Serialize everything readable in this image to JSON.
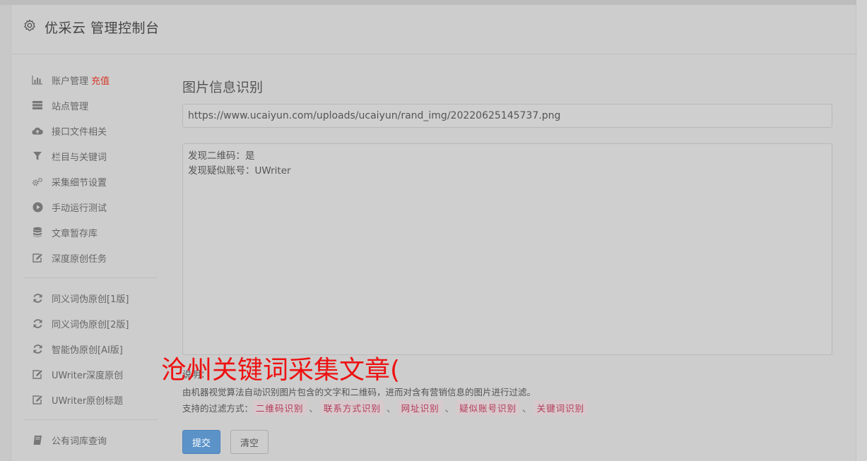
{
  "header": {
    "title": "优采云 管理控制台"
  },
  "sidebar": {
    "group1": [
      {
        "label": "账户管理",
        "badge": "充值",
        "icon": "bar-chart-icon"
      },
      {
        "label": "站点管理",
        "icon": "server-icon"
      },
      {
        "label": "接口文件相关",
        "icon": "cloud-upload-icon"
      },
      {
        "label": "栏目与关键词",
        "icon": "filter-icon"
      },
      {
        "label": "采集细节设置",
        "icon": "cogs-icon"
      },
      {
        "label": "手动运行测试",
        "icon": "play-circle-icon"
      },
      {
        "label": "文章暂存库",
        "icon": "database-icon"
      },
      {
        "label": "深度原创任务",
        "icon": "edit-icon"
      }
    ],
    "group2": [
      {
        "label": "同义词伪原创[1版]",
        "icon": "refresh-icon"
      },
      {
        "label": "同义词伪原创[2版]",
        "icon": "refresh-icon"
      },
      {
        "label": "智能伪原创[AI版]",
        "icon": "refresh-icon"
      },
      {
        "label": "UWriter深度原创",
        "icon": "edit-icon"
      },
      {
        "label": "UWriter原创标题",
        "icon": "edit-icon"
      }
    ],
    "group3": [
      {
        "label": "公有词库查询",
        "icon": "book-icon"
      }
    ]
  },
  "main": {
    "heading": "图片信息识别",
    "url_value": "https://www.ucaiyun.com/uploads/ucaiyun/rand_img/20220625145737.png",
    "result_lines": [
      "发现二维码：是",
      "发现疑似账号：UWriter"
    ],
    "hint_label": "说明：",
    "description": "由机器视觉算法自动识别图片包含的文字和二维码，进而对含有营销信息的图片进行过滤。",
    "methods_label": "支持的过滤方式：",
    "methods": [
      "二维码识别",
      "联系方式识别",
      "网址识别",
      "疑似账号识别",
      "关键词识别"
    ],
    "method_separator": "、",
    "submit_label": "提交",
    "clear_label": "清空"
  },
  "overlay_text": "沧州关键词采集文章(",
  "colors": {
    "primary": "#5b93c9",
    "badge": "#d43a2a",
    "overlay": "#ee1111",
    "tag_text": "#b33a5a"
  }
}
